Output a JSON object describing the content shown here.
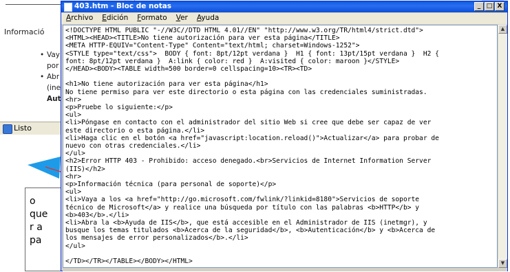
{
  "background_page": {
    "info_label": "Informació",
    "bullets": [
      "Vay",
      "por",
      "Abr",
      "(ine",
      "Aut"
    ],
    "status_text": "Listo"
  },
  "callout": {
    "lines": [
      "o",
      "que",
      "r a",
      "pa"
    ]
  },
  "notepad": {
    "title": "403.htm - Bloc de notas",
    "title_buttons": [
      "_",
      "□",
      "X"
    ],
    "menu": [
      "Archivo",
      "Edición",
      "Formato",
      "Ver",
      "Ayuda"
    ],
    "content": "<!DOCTYPE HTML PUBLIC \"-//W3C//DTD HTML 4.01//EN\" \"http://www.w3.org/TR/html4/strict.dtd\">\n<HTML><HEAD><TITLE>No tiene autorización para ver esta página</TITLE>\n<META HTTP-EQUIV=\"Content-Type\" Content=\"text/html; charset=Windows-1252\">\n<STYLE type=\"text/css\">  BODY { font: 8pt/12pt verdana }  H1 { font: 13pt/15pt verdana }  H2 {\nfont: 8pt/12pt verdana }  A:link { color: red }  A:visited { color: maroon }</STYLE>\n</HEAD><BODY><TABLE width=500 border=0 cellspacing=10><TR><TD>\n\n<h1>No tiene autorización para ver esta página</h1>\nNo tiene permiso para ver este directorio o esta página con las credenciales suministradas.\n<hr>\n<p>Pruebe lo siguiente:</p>\n<ul>\n<li>Póngase en contacto con el administrador del sitio Web si cree que debe ser capaz de ver\neste directorio o esta página.</li>\n<li>Haga clic en el botón <a href=\"javascript:location.reload()\">Actualizar</a> para probar de\nnuevo con otras credenciales.</li>\n</ul>\n<h2>Error HTTP 403 - Prohibido: acceso denegado.<br>Servicios de Internet Information Server\n(IIS)</h2>\n<hr>\n<p>Información técnica (para personal de soporte)</p>\n<ul>\n<li>Vaya a los <a href=\"http://go.microsoft.com/fwlink/?linkid=8180\">Servicios de soporte\ntécnico de Microsoft</a> y realice una búsqueda por título con las palabras <b>HTTP</b> y\n<b>403</b>.</li>\n<li>Abra la <b>Ayuda de IIS</b>, que está accesible en el Administrador de IIS (inetmgr), y\nbusque los temas titulados <b>Acerca de la seguridad</b>, <b>Autenticación</b> y <b>Acerca de\nlos mensajes de error personalizados</b>.</li>\n</ul>\n\n</TD></TR></TABLE></BODY></HTML>"
  },
  "colors": {
    "titlebar": "#0a5de0",
    "callout_line": "#e03030",
    "arrow_fill": "#1e9be8"
  }
}
